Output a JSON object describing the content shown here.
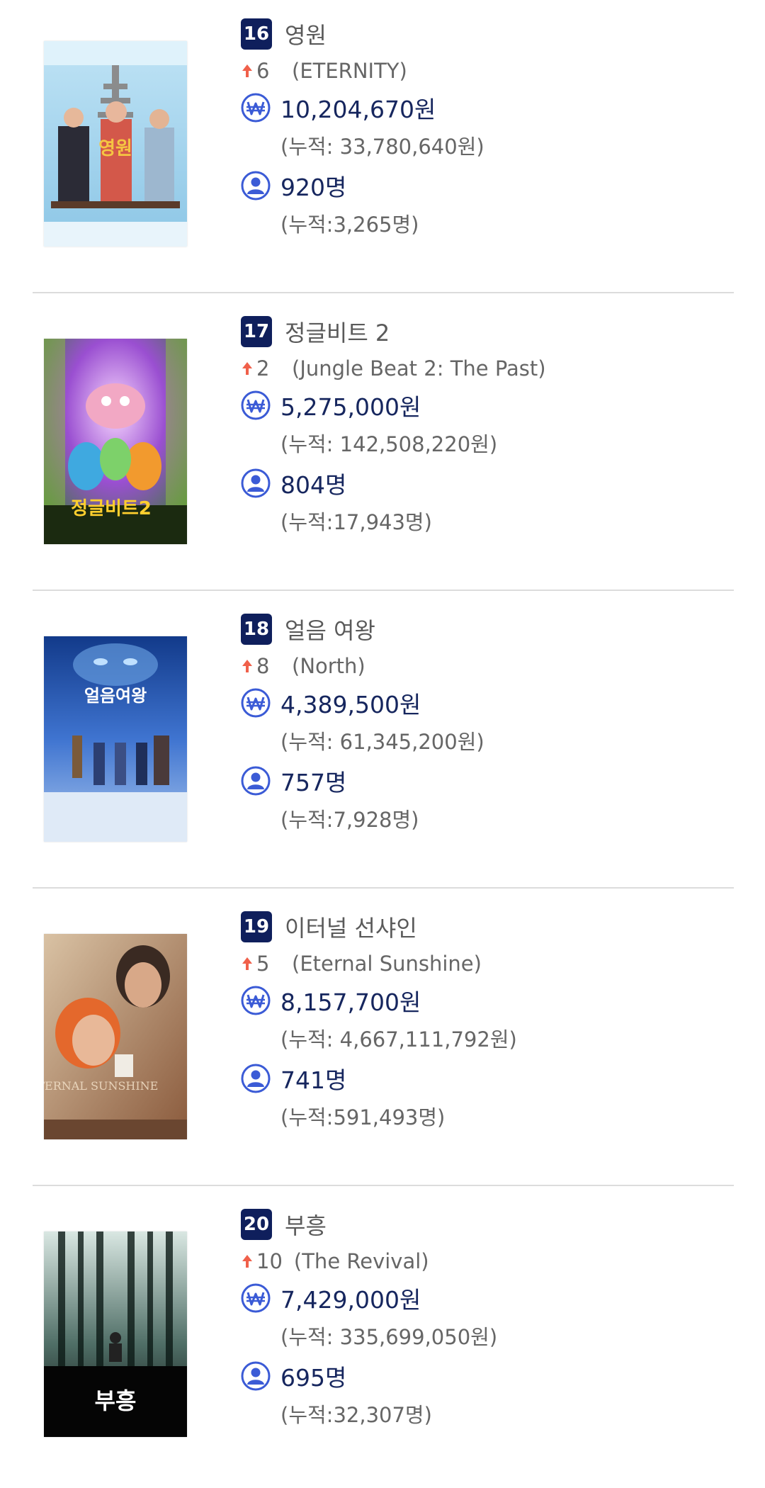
{
  "movies": [
    {
      "rank": "16",
      "title_ko": "영원",
      "rank_change": "6",
      "title_en": "(ETERNITY)",
      "revenue": "10,204,670원",
      "revenue_cumulative": "(누적: 33,780,640원)",
      "audience": "920명",
      "audience_cumulative": "(누적:3,265명)",
      "poster_text": "영원"
    },
    {
      "rank": "17",
      "title_ko": "정글비트 2",
      "rank_change": "2",
      "title_en": "(Jungle Beat 2: The Past)",
      "revenue": "5,275,000원",
      "revenue_cumulative": "(누적: 142,508,220원)",
      "audience": "804명",
      "audience_cumulative": "(누적:17,943명)",
      "poster_text": "정글비트2"
    },
    {
      "rank": "18",
      "title_ko": "얼음 여왕",
      "rank_change": "8",
      "title_en": "(North)",
      "revenue": "4,389,500원",
      "revenue_cumulative": "(누적: 61,345,200원)",
      "audience": "757명",
      "audience_cumulative": "(누적:7,928명)",
      "poster_text": "얼음여왕"
    },
    {
      "rank": "19",
      "title_ko": "이터널 선샤인",
      "rank_change": "5",
      "title_en": "(Eternal Sunshine)",
      "revenue": "8,157,700원",
      "revenue_cumulative": "(누적: 4,667,111,792원)",
      "audience": "741명",
      "audience_cumulative": "(누적:591,493명)",
      "poster_text": "ETERNAL SUNSHINE"
    },
    {
      "rank": "20",
      "title_ko": "부흥",
      "rank_change": "10",
      "title_en": "(The Revival)",
      "revenue": "7,429,000원",
      "revenue_cumulative": "(누적: 335,699,050원)",
      "audience": "695명",
      "audience_cumulative": "(누적:32,307명)",
      "poster_text": "부흥"
    }
  ],
  "icons": {
    "rank_up": "arrow-up-icon",
    "revenue": "won-coin-icon",
    "audience": "person-icon"
  },
  "colors": {
    "badge_bg": "#0f1f5c",
    "value_text": "#16265e",
    "arrow_up": "#f0604a",
    "icon_blue": "#3b5bd6"
  }
}
